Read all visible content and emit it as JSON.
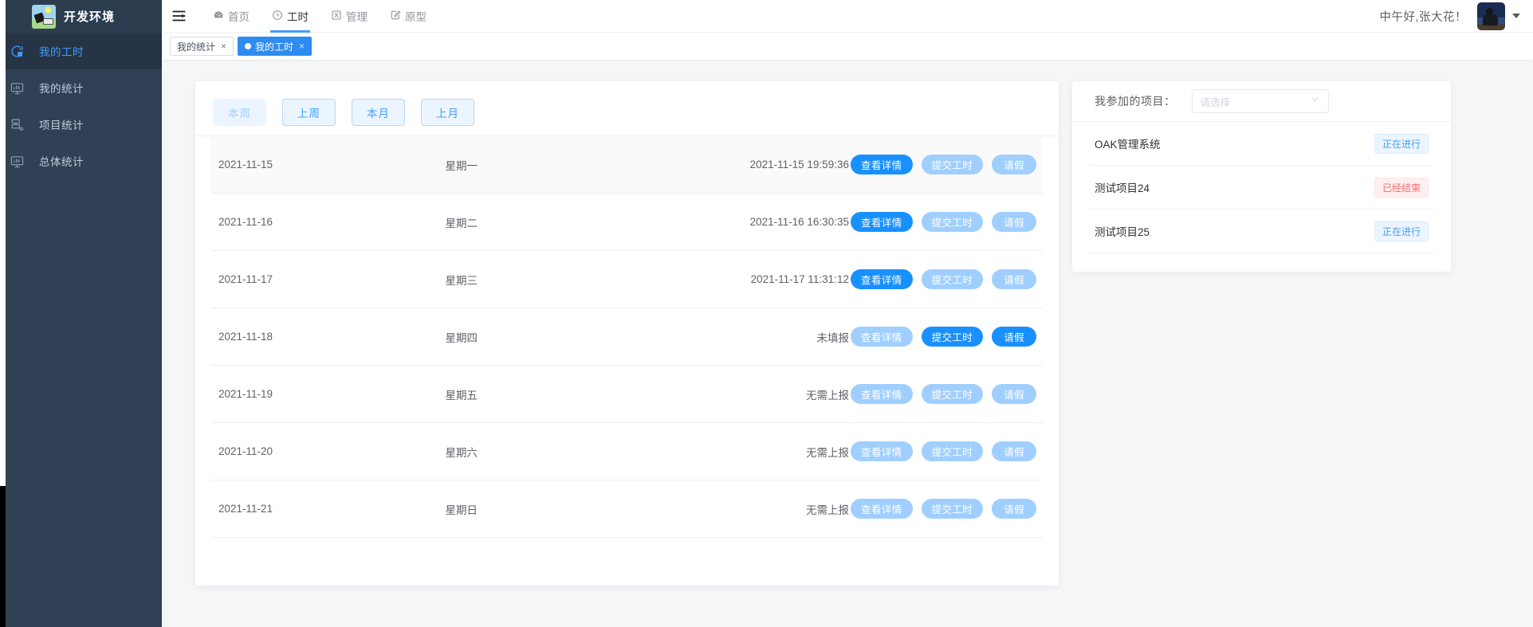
{
  "brand": {
    "name": "开发环境",
    "logo_icon": "app-logo-icon"
  },
  "sidebar": {
    "items": [
      {
        "label": "我的工时",
        "icon": "pie-chart-clock-icon",
        "active": true
      },
      {
        "label": "我的统计",
        "icon": "monitor-chart-icon",
        "active": false
      },
      {
        "label": "项目统计",
        "icon": "server-stack-icon",
        "active": false
      },
      {
        "label": "总体统计",
        "icon": "monitor-icon",
        "active": false
      }
    ]
  },
  "header": {
    "hamburger_icon": "hamburger-menu-icon",
    "nav": [
      {
        "label": "首页",
        "icon": "dashboard-icon",
        "active": false
      },
      {
        "label": "工时",
        "icon": "clock-icon",
        "active": true
      },
      {
        "label": "管理",
        "icon": "settings-box-icon",
        "active": false
      },
      {
        "label": "原型",
        "icon": "edit-square-icon",
        "active": false
      }
    ],
    "greeting": "中午好,张大花！",
    "avatar_icon": "user-avatar",
    "caret_icon": "chevron-down-icon"
  },
  "tagbar": {
    "tags": [
      {
        "label": "我的统计",
        "active": false,
        "close": "×"
      },
      {
        "label": "我的工时",
        "active": true,
        "close": "×"
      }
    ]
  },
  "filters": [
    {
      "label": "本周",
      "disabled": true
    },
    {
      "label": "上周",
      "disabled": false
    },
    {
      "label": "本月",
      "disabled": false
    },
    {
      "label": "上月",
      "disabled": false
    }
  ],
  "actions": {
    "detail": "查看详情",
    "submit": "提交工时",
    "leave": "请假"
  },
  "table": {
    "rows": [
      {
        "date": "2021-11-15",
        "week": "星期一",
        "status": "2021-11-15 19:59:36",
        "hover": true,
        "detail_state": "primary",
        "submit_state": "muted",
        "leave_state": "muted"
      },
      {
        "date": "2021-11-16",
        "week": "星期二",
        "status": "2021-11-16 16:30:35",
        "hover": false,
        "detail_state": "primary",
        "submit_state": "muted",
        "leave_state": "muted"
      },
      {
        "date": "2021-11-17",
        "week": "星期三",
        "status": "2021-11-17 11:31:12",
        "hover": false,
        "detail_state": "primary",
        "submit_state": "muted",
        "leave_state": "muted"
      },
      {
        "date": "2021-11-18",
        "week": "星期四",
        "status": "未填报",
        "hover": false,
        "detail_state": "muted",
        "submit_state": "primary",
        "leave_state": "primary"
      },
      {
        "date": "2021-11-19",
        "week": "星期五",
        "status": "无需上报",
        "hover": false,
        "detail_state": "muted",
        "submit_state": "muted",
        "leave_state": "muted"
      },
      {
        "date": "2021-11-20",
        "week": "星期六",
        "status": "无需上报",
        "hover": false,
        "detail_state": "muted",
        "submit_state": "muted",
        "leave_state": "muted"
      },
      {
        "date": "2021-11-21",
        "week": "星期日",
        "status": "无需上报",
        "hover": false,
        "detail_state": "muted",
        "submit_state": "muted",
        "leave_state": "muted"
      }
    ]
  },
  "projects_panel": {
    "label": "我参加的项目：",
    "select_placeholder": "请选择",
    "select_value": "",
    "items": [
      {
        "name": "OAK管理系统",
        "status": "正在进行",
        "status_type": "ongoing"
      },
      {
        "name": "测试项目24",
        "status": "已经结束",
        "status_type": "ended"
      },
      {
        "name": "测试项目25",
        "status": "正在进行",
        "status_type": "ongoing"
      }
    ]
  },
  "colors": {
    "sidebar_bg": "#304156",
    "sidebar_active_bg": "#263445",
    "accent": "#409eff",
    "primary_button": "#1890ff",
    "muted_button": "#a0cfff",
    "tag_active": "#2d8cf0",
    "danger": "#f56c6c",
    "content_bg": "#f5f6f8"
  }
}
